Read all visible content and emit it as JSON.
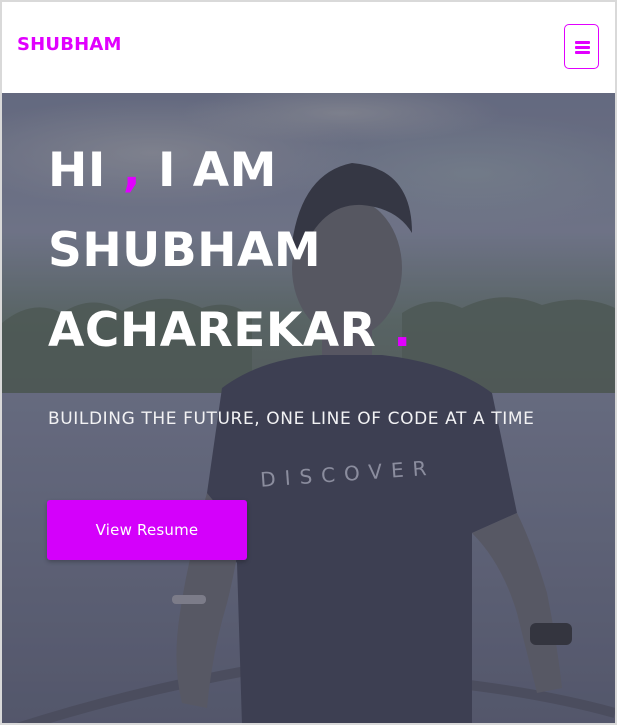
{
  "navbar": {
    "brand": "SHUBHAM",
    "menu_icon": "hamburger-menu-icon"
  },
  "hero": {
    "title_line1_a": "HI",
    "title_line1_comma": ",",
    "title_line1_b": "I AM",
    "title_line2": "SHUBHAM",
    "title_line3": "ACHAREKAR",
    "title_dot": ".",
    "subtitle": "BUILDING THE FUTURE, ONE LINE OF CODE AT A TIME",
    "button_label": "View Resume",
    "background_image": "portrait-photo-man-in-black-tshirt-lakeside",
    "shirt_text": "DISCOVER"
  },
  "colors": {
    "accent": "#e100ff",
    "button_bg": "#d400fb",
    "overlay": "#55576b"
  }
}
